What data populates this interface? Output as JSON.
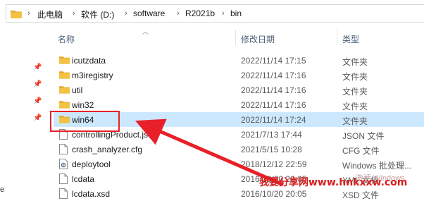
{
  "breadcrumb": {
    "items": [
      "此电脑",
      "软件 (D:)",
      "software",
      "R2021b",
      "bin"
    ],
    "separator": "›"
  },
  "columns": {
    "name": "名称",
    "date": "修改日期",
    "type": "类型"
  },
  "rows": [
    {
      "name": "icutzdata",
      "date": "2022/11/14 17:15",
      "type": "文件夹",
      "icon": "folder-icon"
    },
    {
      "name": "m3iregistry",
      "date": "2022/11/14 17:16",
      "type": "文件夹",
      "icon": "folder-icon"
    },
    {
      "name": "util",
      "date": "2022/11/14 17:16",
      "type": "文件夹",
      "icon": "folder-icon"
    },
    {
      "name": "win32",
      "date": "2022/11/14 17:16",
      "type": "文件夹",
      "icon": "folder-icon"
    },
    {
      "name": "win64",
      "date": "2022/11/14 17:24",
      "type": "文件夹",
      "icon": "folder-icon"
    },
    {
      "name": "controllingProduct.json",
      "date": "2021/7/13 17:44",
      "type": "JSON 文件",
      "icon": "file-icon"
    },
    {
      "name": "crash_analyzer.cfg",
      "date": "2021/5/15 10:28",
      "type": "CFG 文件",
      "icon": "file-icon"
    },
    {
      "name": "deploytool",
      "date": "2018/12/12 22:59",
      "type": "Windows 批处理...",
      "icon": "gear-file-icon"
    },
    {
      "name": "lcdata",
      "date": "2016/10/20 20:05",
      "type": "XML 文档",
      "icon": "file-icon"
    },
    {
      "name": "lcdata.xsd",
      "date": "2016/10/20 20:05",
      "type": "XSD 文件",
      "icon": "file-icon"
    }
  ],
  "left_edge_char": "e",
  "watermark": {
    "text": "我要分享网www.hnkxxw.com",
    "faint_text": "激活 Windows"
  },
  "colors": {
    "highlight_border": "#e8202a",
    "arrow": "#e8202a",
    "folder": "#f3c244",
    "folder_dark": "#e0a82e",
    "selection": "#cce8ff"
  }
}
